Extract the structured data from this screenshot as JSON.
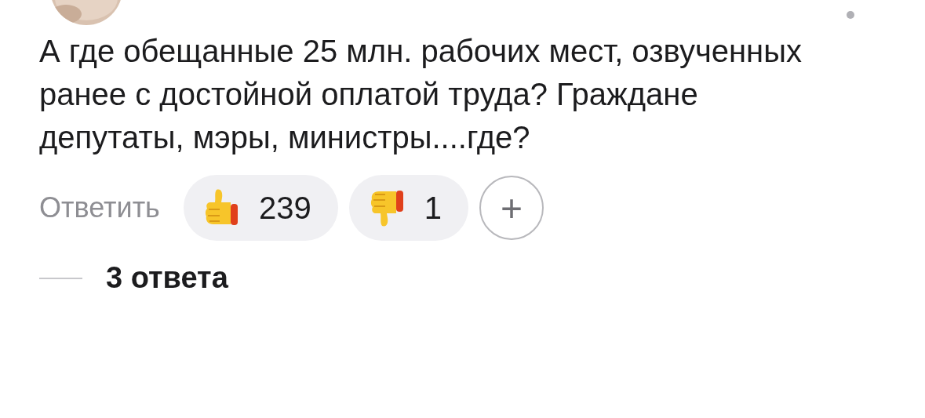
{
  "comment": {
    "text": "А где обещанные 25 млн. рабочих мест, озвученных ранее с достойной оплатой труда? Граждане депутаты, мэры, министры....где?",
    "reply_label": "Ответить",
    "reactions": [
      {
        "kind": "like",
        "count": "239"
      },
      {
        "kind": "dislike",
        "count": "1"
      }
    ],
    "add_reaction": "+",
    "replies_label": "3 ответа"
  }
}
